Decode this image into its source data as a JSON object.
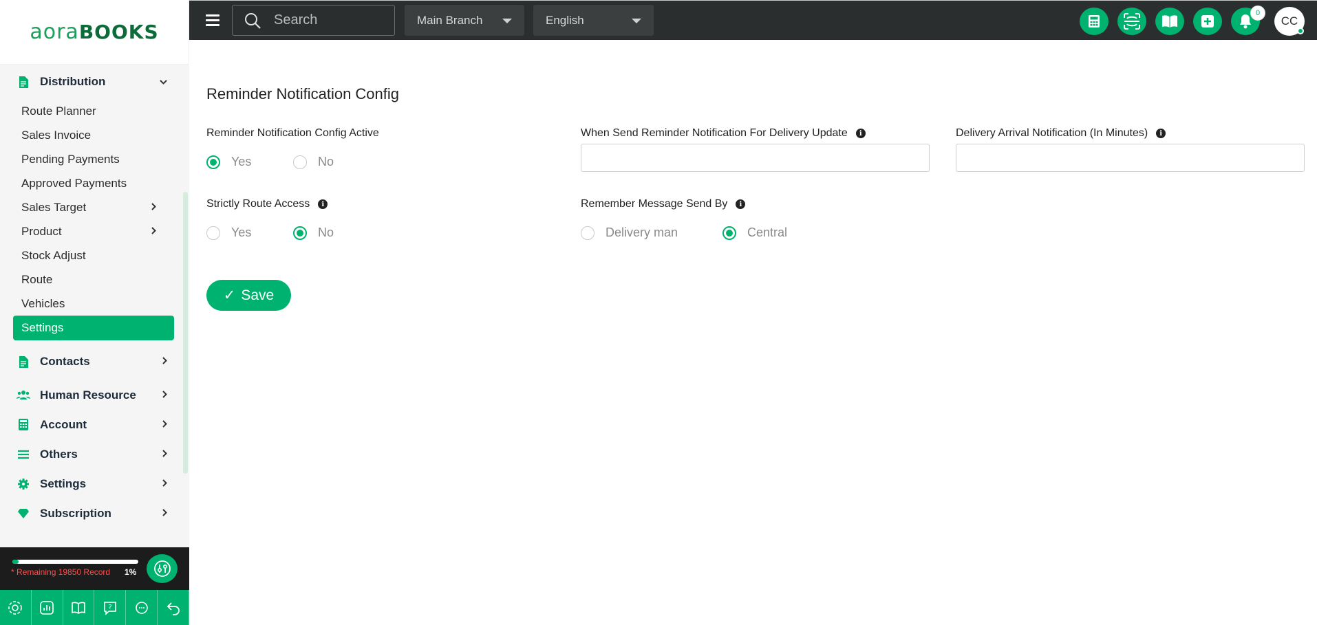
{
  "app": {
    "logo_part1": "aora",
    "logo_part2": "BOOKS"
  },
  "sidebar": {
    "distribution": {
      "label": "Distribution"
    },
    "sub_items": [
      {
        "label": "Route Planner",
        "has_chevron": false
      },
      {
        "label": "Sales Invoice",
        "has_chevron": false
      },
      {
        "label": "Pending Payments",
        "has_chevron": false
      },
      {
        "label": "Approved Payments",
        "has_chevron": false
      },
      {
        "label": "Sales Target",
        "has_chevron": true
      },
      {
        "label": "Product",
        "has_chevron": true
      },
      {
        "label": "Stock Adjust",
        "has_chevron": false
      },
      {
        "label": "Route",
        "has_chevron": false
      },
      {
        "label": "Vehicles",
        "has_chevron": false
      },
      {
        "label": "Settings",
        "has_chevron": false,
        "active": true
      }
    ],
    "groups": [
      {
        "label": "Contacts",
        "icon": "document-icon"
      },
      {
        "label": "Human Resource",
        "icon": "users-icon"
      },
      {
        "label": "Account",
        "icon": "calculator-icon"
      },
      {
        "label": "Others",
        "icon": "list-icon"
      },
      {
        "label": "Settings",
        "icon": "gear-icon"
      },
      {
        "label": "Subscription",
        "icon": "diamond-icon"
      }
    ],
    "records": {
      "remaining_text": "* Remaining 19850 Record",
      "percent": "1%",
      "progress": 0.01
    },
    "tools": [
      "settings-tool-icon",
      "chart-tool-icon",
      "book-tool-icon",
      "help-tool-icon",
      "chat-tool-icon",
      "back-tool-icon"
    ]
  },
  "topbar": {
    "search_label": "Search",
    "branch": "Main Branch",
    "language": "English",
    "notification_count": "0",
    "avatar_initials": "CC",
    "icons": [
      "calculator-icon",
      "scan-icon",
      "book-icon",
      "plus-icon",
      "bell-icon"
    ]
  },
  "form": {
    "title": "Reminder Notification Config",
    "config_active": {
      "label": "Reminder Notification Config Active",
      "yes": "Yes",
      "no": "No",
      "selected": "Yes"
    },
    "send_time": {
      "label": "When Send Reminder Notification For Delivery Update",
      "value": ""
    },
    "arrival": {
      "label": "Delivery Arrival Notification (In Minutes)",
      "value": ""
    },
    "strict_route": {
      "label": "Strictly Route Access",
      "yes": "Yes",
      "no": "No",
      "selected": "No"
    },
    "message_by": {
      "label": "Remember Message Send By",
      "opt1": "Delivery man",
      "opt2": "Central",
      "selected": "Central"
    },
    "save_label": "Save"
  },
  "colors": {
    "accent": "#00b26f",
    "topbar": "#2b2e2f",
    "sidebar_bg": "#f5f5f5",
    "warning": "#ff4d4d"
  }
}
